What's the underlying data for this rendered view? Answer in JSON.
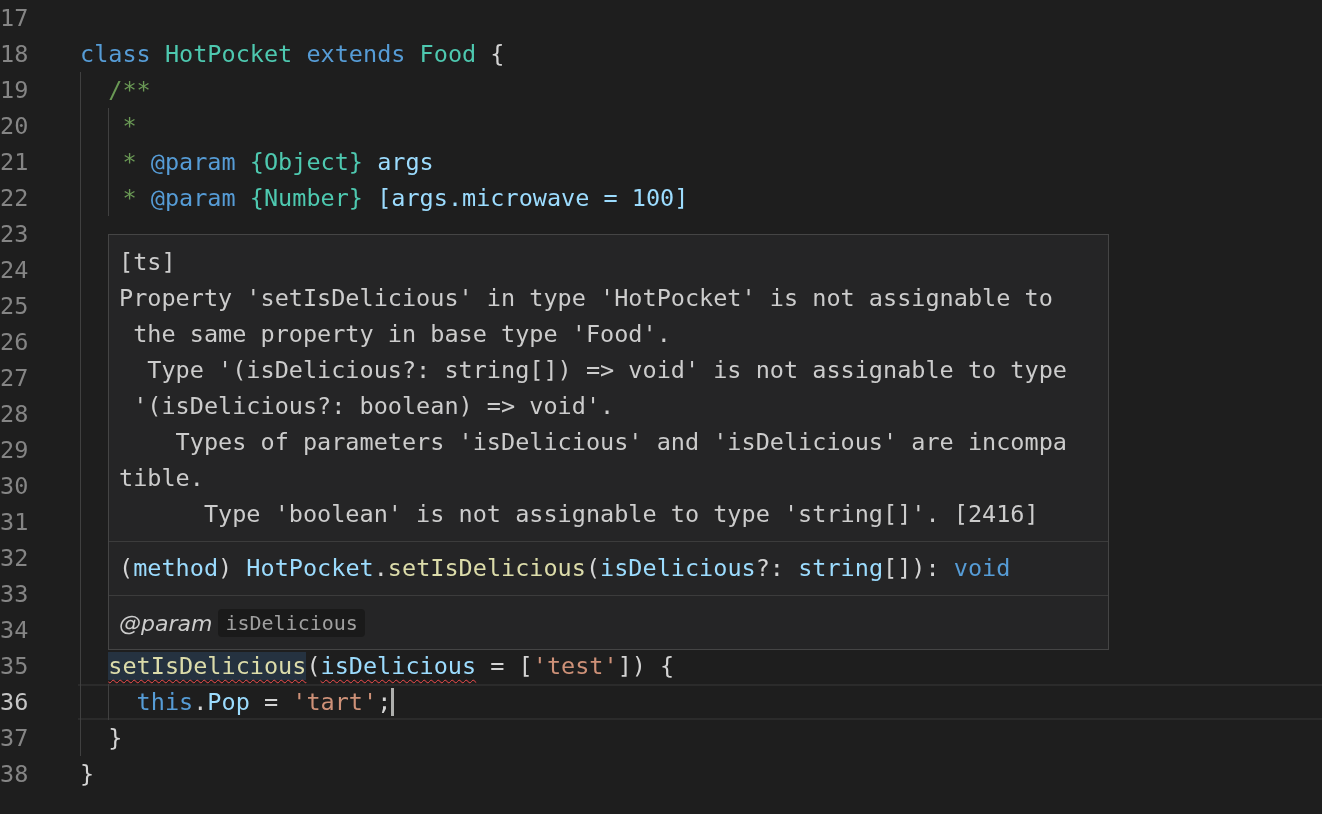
{
  "editor": {
    "lines": [
      {
        "number": "17",
        "current": false
      },
      {
        "number": "18",
        "current": false,
        "tokens": [
          {
            "text": "class",
            "kind": "keyword"
          },
          {
            "text": " HotPocket",
            "kind": "class"
          },
          {
            "text": " extends",
            "kind": "keyword"
          },
          {
            "text": " Food",
            "kind": "class"
          },
          {
            "text": " {",
            "kind": "plain"
          }
        ]
      },
      {
        "number": "19",
        "current": false,
        "tokens": [
          {
            "text": "  /**",
            "kind": "comment"
          }
        ]
      },
      {
        "number": "20",
        "current": false,
        "tokens": [
          {
            "text": "   *",
            "kind": "comment"
          }
        ]
      },
      {
        "number": "21",
        "current": false,
        "tokens": [
          {
            "text": "   *",
            "kind": "comment"
          },
          {
            "text": " @param",
            "kind": "keyword"
          },
          {
            "text": " {Object}",
            "kind": "class"
          },
          {
            "text": " args",
            "kind": "variable"
          }
        ]
      },
      {
        "number": "22",
        "current": false,
        "tokens": [
          {
            "text": "   *",
            "kind": "comment"
          },
          {
            "text": " @param",
            "kind": "keyword"
          },
          {
            "text": " {Number}",
            "kind": "class"
          },
          {
            "text": " [args.microwave = 100]",
            "kind": "variable"
          }
        ]
      },
      {
        "number": "23",
        "current": false
      },
      {
        "number": "24",
        "current": false
      },
      {
        "number": "25",
        "current": false
      },
      {
        "number": "26",
        "current": false
      },
      {
        "number": "27",
        "current": false
      },
      {
        "number": "28",
        "current": false
      },
      {
        "number": "29",
        "current": false
      },
      {
        "number": "30",
        "current": false
      },
      {
        "number": "31",
        "current": false
      },
      {
        "number": "32",
        "current": false
      },
      {
        "number": "33",
        "current": false
      },
      {
        "number": "34",
        "current": false
      },
      {
        "number": "35",
        "current": false,
        "tokens": [
          {
            "text": "  setIsDelicious",
            "kind": "function-error"
          },
          {
            "text": "(",
            "kind": "plain"
          },
          {
            "text": "isDelicious",
            "kind": "parameter-error"
          },
          {
            "text": " = [",
            "kind": "plain"
          },
          {
            "text": "'test'",
            "kind": "string"
          },
          {
            "text": "]) {",
            "kind": "plain"
          }
        ]
      },
      {
        "number": "36",
        "current": true,
        "tokens": [
          {
            "text": "    this",
            "kind": "keyword"
          },
          {
            "text": ".",
            "kind": "plain"
          },
          {
            "text": "Pop",
            "kind": "variable"
          },
          {
            "text": " = ",
            "kind": "plain"
          },
          {
            "text": "'tart'",
            "kind": "string"
          },
          {
            "text": ";",
            "kind": "plain"
          }
        ]
      },
      {
        "number": "37",
        "current": false,
        "tokens": [
          {
            "text": "  }",
            "kind": "plain"
          }
        ]
      },
      {
        "number": "38",
        "current": false,
        "tokens": [
          {
            "text": "}",
            "kind": "plain"
          }
        ]
      }
    ]
  },
  "hover": {
    "source": "[ts]",
    "message": [
      "Property 'setIsDelicious' in type 'HotPocket' is not assignable to",
      " the same property in base type 'Food'.",
      "  Type '(isDelicious?: string[]) => void' is not assignable to type",
      " '(isDelicious?: boolean) => void'.",
      "    Types of parameters 'isDelicious' and 'isDelicious' are incompa",
      "tible.",
      "      Type 'boolean' is not assignable to type 'string[]'. [2416]"
    ],
    "signature": [
      {
        "text": "(",
        "kind": "plain"
      },
      {
        "text": "method",
        "kind": "variable"
      },
      {
        "text": ") ",
        "kind": "plain"
      },
      {
        "text": "HotPocket",
        "kind": "variable"
      },
      {
        "text": ".",
        "kind": "plain"
      },
      {
        "text": "setIsDelicious",
        "kind": "function"
      },
      {
        "text": "(",
        "kind": "plain"
      },
      {
        "text": "isDelicious",
        "kind": "variable"
      },
      {
        "text": "?: ",
        "kind": "plain"
      },
      {
        "text": "string",
        "kind": "variable"
      },
      {
        "text": "[]): ",
        "kind": "plain"
      },
      {
        "text": "void",
        "kind": "keyword"
      }
    ],
    "param_tag": "@param",
    "param_name": "isDelicious"
  }
}
